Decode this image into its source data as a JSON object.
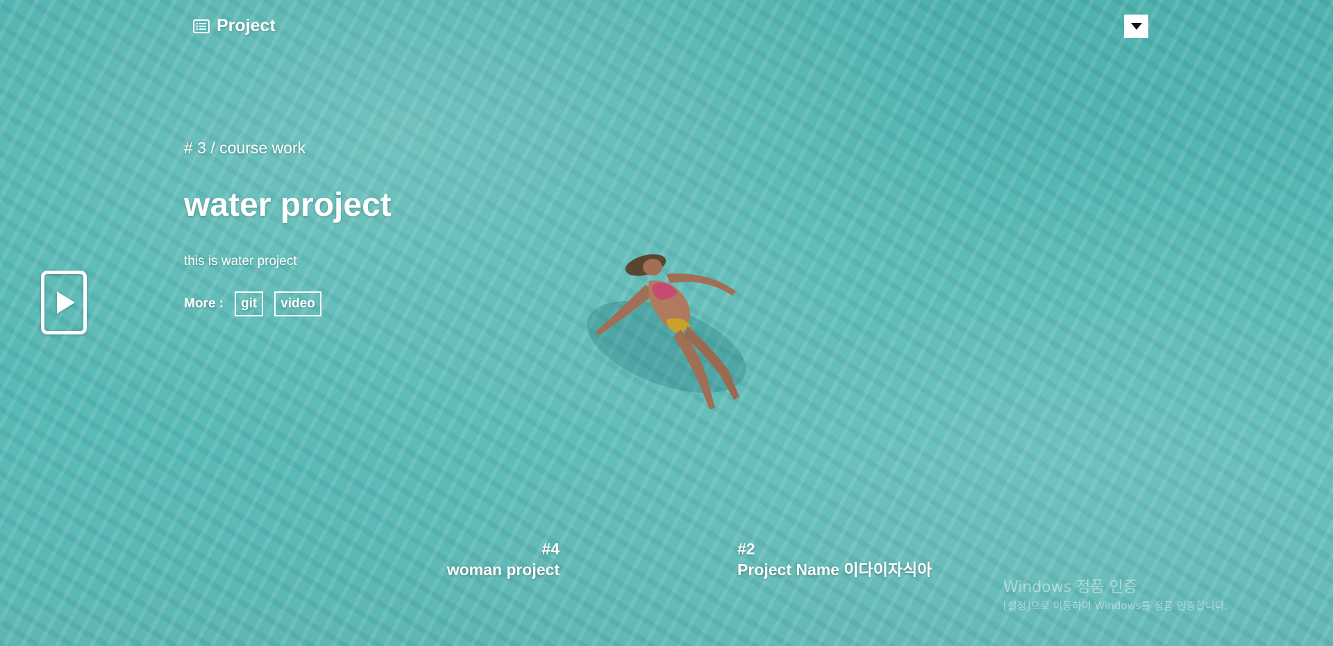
{
  "header": {
    "title": "Project",
    "menu_icon": "list-icon",
    "toggle_icon": "caret-down-icon"
  },
  "current_slide": {
    "number_line": "# 3 / course work",
    "title": "water project",
    "description": "this is water project",
    "more_label": "More :",
    "links": [
      {
        "label": "git"
      },
      {
        "label": "video"
      }
    ]
  },
  "play_button": {
    "icon": "play-icon"
  },
  "slide_nav": {
    "prev": {
      "number": "#4",
      "name": "woman project"
    },
    "next": {
      "number": "#2",
      "name": "Project Name 이다이자식아"
    }
  },
  "watermark": {
    "title": "Windows 정품 인증",
    "subtitle": "[설정]으로 이동하여 Windows를 정품 인증합니다."
  },
  "colors": {
    "water": "#56b8b3",
    "text": "#ffffff"
  }
}
